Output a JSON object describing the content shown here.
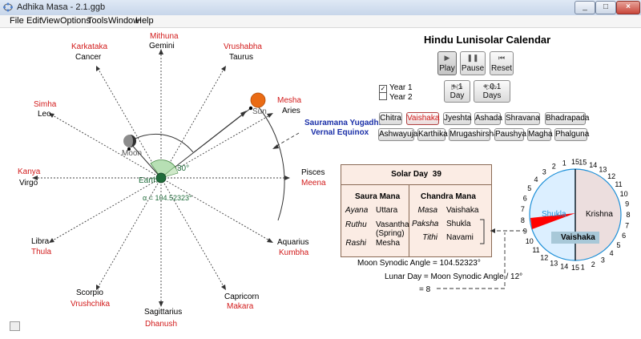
{
  "window": {
    "title": "Adhika Masa - 2.1.ggb",
    "controls": [
      "_",
      "□",
      "×"
    ]
  },
  "menu": [
    "File",
    "Edit",
    "View",
    "Options",
    "Tools",
    "Window",
    "Help"
  ],
  "zodiac": [
    {
      "sanskrit": "Mithuna",
      "english": "Gemini"
    },
    {
      "sanskrit": "Vrushabha",
      "english": "Taurus"
    },
    {
      "sanskrit": "Karkataka",
      "english": "Cancer"
    },
    {
      "sanskrit": "Simha",
      "english": "Leo"
    },
    {
      "sanskrit": "Mesha",
      "english": "Aries"
    },
    {
      "sanskrit": "Kanya",
      "english": "Virgo"
    },
    {
      "sanskrit": "Meena",
      "english": "Pisces"
    },
    {
      "sanskrit": "Thula",
      "english": "Libra"
    },
    {
      "sanskrit": "Kumbha",
      "english": "Aquarius"
    },
    {
      "sanskrit": "Vrushchika",
      "english": "Scorpio"
    },
    {
      "sanskrit": "Makara",
      "english": "Capricorn"
    },
    {
      "sanskrit": "Dhanush",
      "english": "Sagittarius"
    }
  ],
  "orbit": {
    "sun_label": "Sun",
    "moon_label": "Moon",
    "earth_label": "Earth",
    "angle_label": "30°",
    "alpha_label": "α = 104.52323°",
    "equinox_line1": "Sauramana Yugadhi",
    "equinox_line2": "Vernal Equinox"
  },
  "calendar": {
    "title": "Hindu Lunisolar Calendar",
    "buttons": {
      "play": "Play",
      "pause": "Pause",
      "reset": "Reset",
      "one_day": "+ 1 Day",
      "tenth_day": "+ 0.1 Days"
    },
    "years": [
      {
        "label": "Year 1",
        "checked": true
      },
      {
        "label": "Year 2",
        "checked": false
      }
    ],
    "months_row1": [
      "Chitra",
      "Vaishaka",
      "Jyeshta",
      "Ashada",
      "Shravana",
      "Bhadrapada"
    ],
    "months_row2": [
      "Ashwayuja",
      "Karthika",
      "Mrugashirsha",
      "Paushya",
      "Magha",
      "Phalguna"
    ],
    "active_month": "Vaishaka"
  },
  "solar_panel": {
    "header_label": "Solar Day",
    "day": "39",
    "saura_title": "Saura Mana",
    "chandra_title": "Chandra Mana",
    "ayana_label": "Ayana",
    "ayana": "Uttara",
    "ruthu_label": "Ruthu",
    "ruthu_line1": "Vasantha",
    "ruthu_line2": "(Spring)",
    "rashi_label": "Rashi",
    "rashi": "Mesha",
    "masa_label": "Masa",
    "masa": "Vaishaka",
    "paksha_label": "Paksha",
    "paksha": "Shukla",
    "tithi_label": "Tithi",
    "tithi": "Navami"
  },
  "formula": {
    "line1": "Moon Synodic Angle  =  104.52323°",
    "line2": "Lunar Day  =  Moon Synodic Angle / 12°",
    "line3": "=  8"
  },
  "tithi_dial": {
    "shukla_label": "Shukla",
    "krishna_label": "Krishna",
    "month_label": "Vaishaka",
    "left_numbers": [
      "15",
      "1",
      "2",
      "3",
      "4",
      "5",
      "6",
      "7",
      "8",
      "9",
      "10",
      "11",
      "12",
      "13",
      "14",
      "15"
    ],
    "right_numbers": [
      "15",
      "14",
      "13",
      "12",
      "11",
      "10",
      "9",
      "8",
      "7",
      "6",
      "5",
      "4",
      "3",
      "2",
      "1"
    ],
    "current_tithi": 9
  },
  "colors": {
    "red_label": "#d21b1b",
    "equinox_blue": "#1a2fa8",
    "shukla_fill": "#dcefff",
    "krishna_fill": "#ecdede",
    "pointer": "#ff0000",
    "earth": "#1f6b3a"
  }
}
